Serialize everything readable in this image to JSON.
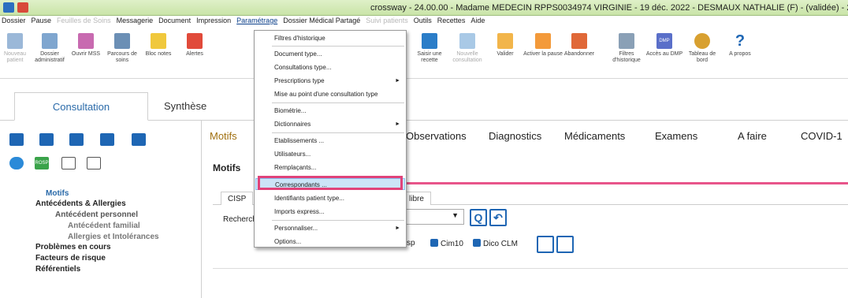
{
  "window": {
    "title": "crossway - 24.00.00 - Madame MEDECIN RPPS0034974 VIRGINIE - 19 déc. 2022 - DESMAUX NATHALIE (F) - (validée) - 2 ans - né"
  },
  "menubar": {
    "items": [
      "Dossier",
      "Pause",
      "Feuilles de Soins",
      "Messagerie",
      "Document",
      "Impression",
      "Paramétrage",
      "Dossier Médical Partagé",
      "Suivi patients",
      "Outils",
      "Recettes",
      "Aide"
    ]
  },
  "toolbar": {
    "items": [
      "Nouveau patient",
      "Dossier administratif",
      "Ouvrir MSS",
      "Parcours de soins",
      "Bloc notes",
      "Alertes",
      "Saisir une recette",
      "Nouvelle consultation",
      "Valider",
      "Activer la pause",
      "Abandonner",
      "Filtres d'historique",
      "Accès au DMP",
      "Tableau de bord",
      "A propos"
    ],
    "dmp_badge": "DMP"
  },
  "main_tabs": {
    "consultation": "Consultation",
    "synthese": "Synthèse"
  },
  "dropdown": {
    "items": [
      "Filtres d'historique",
      "Document type...",
      "Consultations type...",
      "Prescriptions type",
      "Mise au point d'une consultation type",
      "Biométrie...",
      "Dictionnaires",
      "Etablissements ...",
      "Utilisateurs...",
      "Remplaçants...",
      "Correspondants ...",
      "Identifiants patient type...",
      "Imports express...",
      "Personnaliser...",
      "Options..."
    ]
  },
  "subtabs": [
    "Motifs",
    "Observations",
    "Diagnostics",
    "Médicaments",
    "Examens",
    "A faire",
    "COVID-1"
  ],
  "left_tree": {
    "motifs": "Motifs",
    "antecedents": "Antécédents & Allergies",
    "perso": "Antécédent personnel",
    "familial": "Antécédent familial",
    "allergies": "Allergies et Intolérances",
    "problemes": "Problèmes en cours",
    "facteurs": "Facteurs de risque",
    "referentiels": "Référentiels",
    "rosp": "ROSP"
  },
  "motifs_panel": {
    "title": "Motifs",
    "tabs": [
      "CISP",
      "libre"
    ],
    "search_label": "Recherch",
    "checks": [
      "sp",
      "Cim10",
      "Dico CLM"
    ]
  },
  "colors": {
    "accent": "#1e66b4",
    "highlight": "#e0437a",
    "titlebar": "#cfe7b2"
  }
}
